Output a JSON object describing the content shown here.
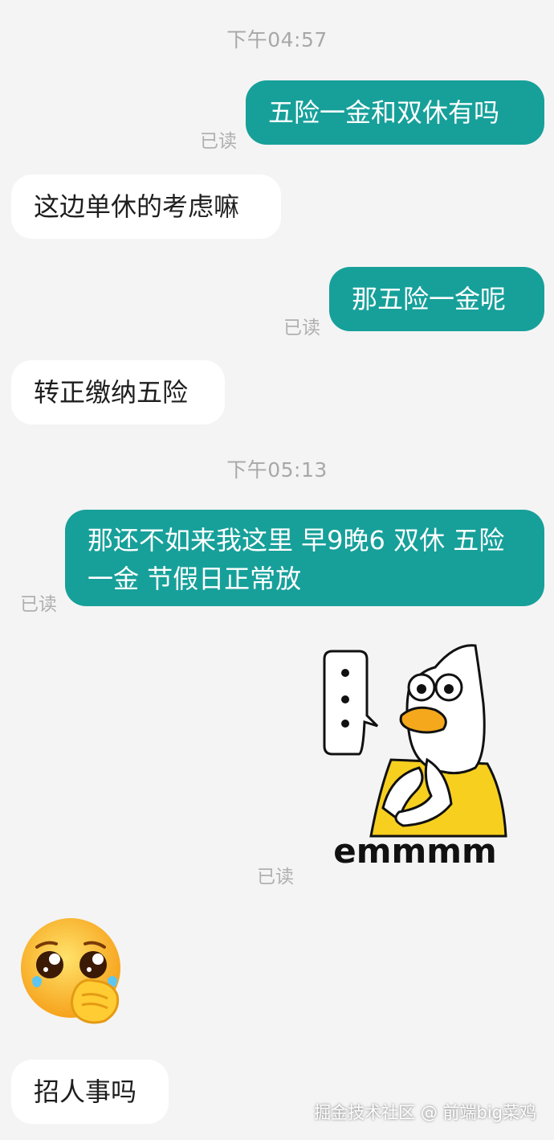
{
  "chat": {
    "timestamps": [
      "下午04:57",
      "下午05:13"
    ],
    "read_label": "已读",
    "messages": [
      {
        "text": "五险一金和双休有吗"
      },
      {
        "text": "这边单休的考虑嘛"
      },
      {
        "text": "那五险一金呢"
      },
      {
        "text": "转正缴纳五险"
      },
      {
        "text": "那还不如来我这里 早9晚6 双休 五险一金 节假日正常放"
      },
      {
        "sticker_caption": "emmmm"
      },
      {
        "emoji": "pleading-face-emoji"
      },
      {
        "text": "招人事吗"
      }
    ]
  },
  "watermark": "掘金技术社区 @ 前端big菜鸡",
  "colors": {
    "background": "#f4f4f4",
    "outgoing_bubble": "#17a09a",
    "incoming_bubble": "#ffffff",
    "meta_text": "#a8a8a8"
  }
}
